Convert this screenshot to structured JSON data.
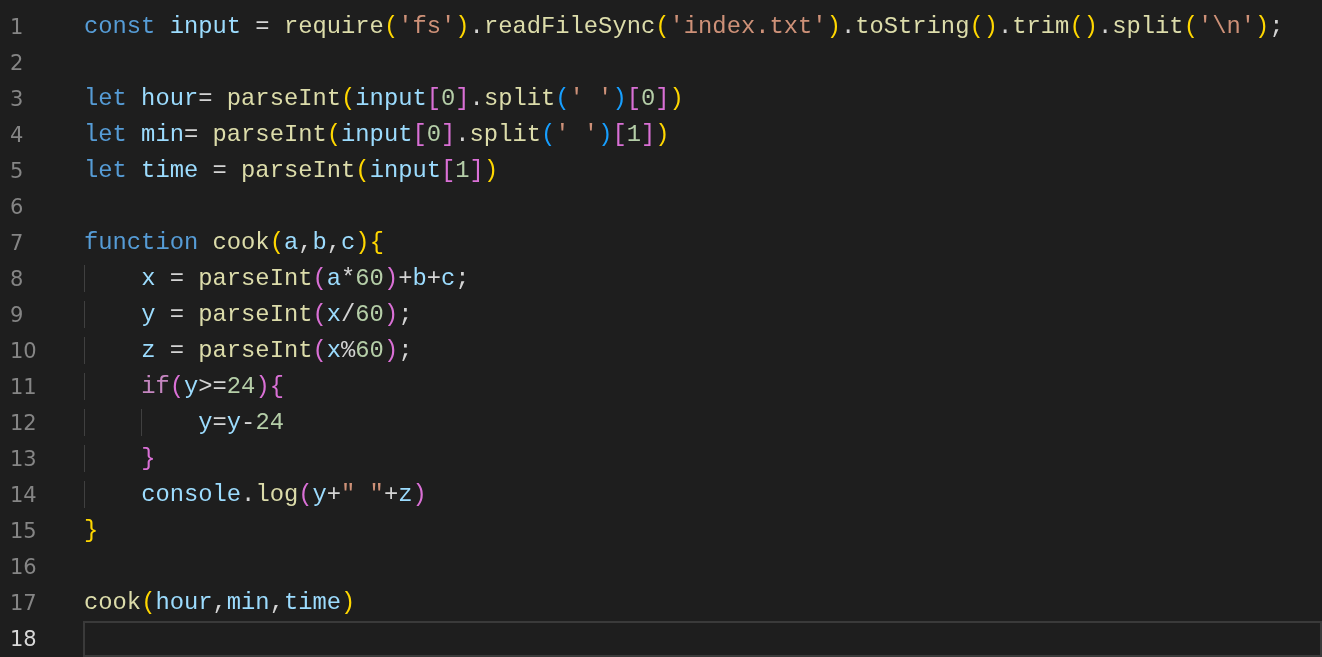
{
  "editor": {
    "lines": [
      {
        "number": "1",
        "selected": false,
        "tokens": [
          {
            "text": "const",
            "kind": "kw"
          },
          {
            "text": " input",
            "kind": "var"
          },
          {
            "text": " = ",
            "kind": "plain"
          },
          {
            "text": "require",
            "kind": "fn"
          },
          {
            "text": "(",
            "kind": "br1"
          },
          {
            "text": "'fs'",
            "kind": "str"
          },
          {
            "text": ")",
            "kind": "br1"
          },
          {
            "text": ".",
            "kind": "plain"
          },
          {
            "text": "readFileSync",
            "kind": "fn"
          },
          {
            "text": "(",
            "kind": "br1"
          },
          {
            "text": "'index.txt'",
            "kind": "str"
          },
          {
            "text": ")",
            "kind": "br1"
          },
          {
            "text": ".",
            "kind": "plain"
          },
          {
            "text": "toString",
            "kind": "fn"
          },
          {
            "text": "()",
            "kind": "br1"
          },
          {
            "text": ".",
            "kind": "plain"
          },
          {
            "text": "trim",
            "kind": "fn"
          },
          {
            "text": "()",
            "kind": "br1"
          },
          {
            "text": ".",
            "kind": "plain"
          },
          {
            "text": "split",
            "kind": "fn"
          },
          {
            "text": "(",
            "kind": "br1"
          },
          {
            "text": "'\\n'",
            "kind": "str"
          },
          {
            "text": ")",
            "kind": "br1"
          },
          {
            "text": ";",
            "kind": "plain"
          }
        ]
      },
      {
        "number": "2",
        "selected": false
      },
      {
        "number": "3",
        "selected": false,
        "tokens": [
          {
            "text": "let",
            "kind": "kw"
          },
          {
            "text": " hour",
            "kind": "var"
          },
          {
            "text": "= ",
            "kind": "plain"
          },
          {
            "text": "parseInt",
            "kind": "fn"
          },
          {
            "text": "(",
            "kind": "br1"
          },
          {
            "text": "input",
            "kind": "var"
          },
          {
            "text": "[",
            "kind": "br2"
          },
          {
            "text": "0",
            "kind": "num"
          },
          {
            "text": "]",
            "kind": "br2"
          },
          {
            "text": ".",
            "kind": "plain"
          },
          {
            "text": "split",
            "kind": "fn"
          },
          {
            "text": "(",
            "kind": "br3"
          },
          {
            "text": "' '",
            "kind": "str"
          },
          {
            "text": ")",
            "kind": "br3"
          },
          {
            "text": "[",
            "kind": "br2"
          },
          {
            "text": "0",
            "kind": "num"
          },
          {
            "text": "]",
            "kind": "br2"
          },
          {
            "text": ")",
            "kind": "br1"
          }
        ]
      },
      {
        "number": "4",
        "selected": false,
        "tokens": [
          {
            "text": "let",
            "kind": "kw"
          },
          {
            "text": " min",
            "kind": "var"
          },
          {
            "text": "= ",
            "kind": "plain"
          },
          {
            "text": "parseInt",
            "kind": "fn"
          },
          {
            "text": "(",
            "kind": "br1"
          },
          {
            "text": "input",
            "kind": "var"
          },
          {
            "text": "[",
            "kind": "br2"
          },
          {
            "text": "0",
            "kind": "num"
          },
          {
            "text": "]",
            "kind": "br2"
          },
          {
            "text": ".",
            "kind": "plain"
          },
          {
            "text": "split",
            "kind": "fn"
          },
          {
            "text": "(",
            "kind": "br3"
          },
          {
            "text": "' '",
            "kind": "str"
          },
          {
            "text": ")",
            "kind": "br3"
          },
          {
            "text": "[",
            "kind": "br2"
          },
          {
            "text": "1",
            "kind": "num"
          },
          {
            "text": "]",
            "kind": "br2"
          },
          {
            "text": ")",
            "kind": "br1"
          }
        ]
      },
      {
        "number": "5",
        "selected": false,
        "tokens": [
          {
            "text": "let",
            "kind": "kw"
          },
          {
            "text": " time",
            "kind": "var"
          },
          {
            "text": " = ",
            "kind": "plain"
          },
          {
            "text": "parseInt",
            "kind": "fn"
          },
          {
            "text": "(",
            "kind": "br1"
          },
          {
            "text": "input",
            "kind": "var"
          },
          {
            "text": "[",
            "kind": "br2"
          },
          {
            "text": "1",
            "kind": "num"
          },
          {
            "text": "]",
            "kind": "br2"
          },
          {
            "text": ")",
            "kind": "br1"
          }
        ]
      },
      {
        "number": "6",
        "selected": false
      },
      {
        "number": "7",
        "selected": false,
        "tokens": [
          {
            "text": "function",
            "kind": "kw"
          },
          {
            "text": " cook",
            "kind": "fn"
          },
          {
            "text": "(",
            "kind": "br1"
          },
          {
            "text": "a",
            "kind": "var"
          },
          {
            "text": ",",
            "kind": "plain"
          },
          {
            "text": "b",
            "kind": "var"
          },
          {
            "text": ",",
            "kind": "plain"
          },
          {
            "text": "c",
            "kind": "var"
          },
          {
            "text": ")",
            "kind": "br1"
          },
          {
            "text": "{",
            "kind": "br1"
          }
        ]
      },
      {
        "number": "8",
        "selected": false,
        "tokens": [
          {
            "text": "    x",
            "kind": "var"
          },
          {
            "text": " = ",
            "kind": "plain"
          },
          {
            "text": "parseInt",
            "kind": "fn"
          },
          {
            "text": "(",
            "kind": "br2"
          },
          {
            "text": "a",
            "kind": "var"
          },
          {
            "text": "*",
            "kind": "plain"
          },
          {
            "text": "60",
            "kind": "num"
          },
          {
            "text": ")",
            "kind": "br2"
          },
          {
            "text": "+",
            "kind": "plain"
          },
          {
            "text": "b",
            "kind": "var"
          },
          {
            "text": "+",
            "kind": "plain"
          },
          {
            "text": "c",
            "kind": "var"
          },
          {
            "text": ";",
            "kind": "plain"
          }
        ]
      },
      {
        "number": "9",
        "selected": false,
        "tokens": [
          {
            "text": "    y",
            "kind": "var"
          },
          {
            "text": " = ",
            "kind": "plain"
          },
          {
            "text": "parseInt",
            "kind": "fn"
          },
          {
            "text": "(",
            "kind": "br2"
          },
          {
            "text": "x",
            "kind": "var"
          },
          {
            "text": "/",
            "kind": "plain"
          },
          {
            "text": "60",
            "kind": "num"
          },
          {
            "text": ")",
            "kind": "br2"
          },
          {
            "text": ";",
            "kind": "plain"
          }
        ]
      },
      {
        "number": "10",
        "selected": false,
        "tokens": [
          {
            "text": "    z",
            "kind": "var"
          },
          {
            "text": " = ",
            "kind": "plain"
          },
          {
            "text": "parseInt",
            "kind": "fn"
          },
          {
            "text": "(",
            "kind": "br2"
          },
          {
            "text": "x",
            "kind": "var"
          },
          {
            "text": "%",
            "kind": "plain"
          },
          {
            "text": "60",
            "kind": "num"
          },
          {
            "text": ")",
            "kind": "br2"
          },
          {
            "text": ";",
            "kind": "plain"
          }
        ]
      },
      {
        "number": "11",
        "selected": false,
        "tokens": [
          {
            "text": "    if",
            "kind": "ctl"
          },
          {
            "text": "(",
            "kind": "br2"
          },
          {
            "text": "y",
            "kind": "var"
          },
          {
            "text": ">=",
            "kind": "plain"
          },
          {
            "text": "24",
            "kind": "num"
          },
          {
            "text": ")",
            "kind": "br2"
          },
          {
            "text": "{",
            "kind": "br2"
          }
        ]
      },
      {
        "number": "12",
        "selected": false,
        "tokens": [
          {
            "text": "        y",
            "kind": "var"
          },
          {
            "text": "=",
            "kind": "plain"
          },
          {
            "text": "y",
            "kind": "var"
          },
          {
            "text": "-",
            "kind": "plain"
          },
          {
            "text": "24",
            "kind": "num"
          }
        ]
      },
      {
        "number": "13",
        "selected": false,
        "tokens": [
          {
            "text": "    }",
            "kind": "br2"
          }
        ]
      },
      {
        "number": "14",
        "selected": false,
        "tokens": [
          {
            "text": "    console",
            "kind": "var"
          },
          {
            "text": ".",
            "kind": "plain"
          },
          {
            "text": "log",
            "kind": "fn"
          },
          {
            "text": "(",
            "kind": "br2"
          },
          {
            "text": "y",
            "kind": "var"
          },
          {
            "text": "+",
            "kind": "plain"
          },
          {
            "text": "\" \"",
            "kind": "str"
          },
          {
            "text": "+",
            "kind": "plain"
          },
          {
            "text": "z",
            "kind": "var"
          },
          {
            "text": ")",
            "kind": "br2"
          }
        ]
      },
      {
        "number": "15",
        "selected": false,
        "tokens": [
          {
            "text": "}",
            "kind": "br1"
          }
        ]
      },
      {
        "number": "16",
        "selected": false
      },
      {
        "number": "17",
        "selected": false,
        "tokens": [
          {
            "text": "cook",
            "kind": "fn"
          },
          {
            "text": "(",
            "kind": "br1"
          },
          {
            "text": "hour",
            "kind": "var"
          },
          {
            "text": ",",
            "kind": "plain"
          },
          {
            "text": "min",
            "kind": "var"
          },
          {
            "text": ",",
            "kind": "plain"
          },
          {
            "text": "time",
            "kind": "var"
          },
          {
            "text": ")",
            "kind": "br1"
          }
        ]
      },
      {
        "number": "18",
        "selected": true
      }
    ]
  }
}
